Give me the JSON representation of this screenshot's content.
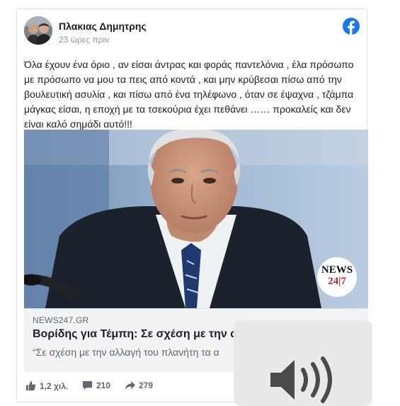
{
  "post": {
    "author": "Πλακιας Δημητρης",
    "time": "23 ώρες πριν",
    "text": "Όλα έχουν ένα όριο , αν είσαι άντρας και φοράς παντελόνια , έλα πρόσωπο με πρόσωπο να μου τα πεις από κοντά , και μην κρύβεσαι πίσω από την βουλευτική ασυλία , και πίσω από ένα τηλέφωνο , όταν σε έψαχνα , τζάμπα μάγκας είσαι, η εποχή με τα τσεκούρια έχει πεθάνει …… προκαλείς και δεν είναι καλό σημάδι αυτό!!!"
  },
  "link": {
    "domain": "NEWS247.GR",
    "title": "Βορίδης για Τέμπη: Σε σχέση με την α",
    "description": "“Σε σχέση με την αλλαγή του πλανήτη τα α",
    "watermark_top": "NEWS",
    "watermark_bottom": "24|7"
  },
  "stats": {
    "likes": "1,2 χιλ.",
    "comments": "210",
    "shares": "279"
  },
  "colors": {
    "facebook_blue": "#1877f2",
    "text_primary": "#1c1e21",
    "text_secondary": "#606770",
    "news_red": "#d32027"
  },
  "icons": {
    "facebook": "facebook-logo-icon",
    "like": "thumbs-up-icon",
    "comment": "comment-bubble-icon",
    "share": "share-arrow-icon",
    "volume": "speaker-volume-icon"
  }
}
